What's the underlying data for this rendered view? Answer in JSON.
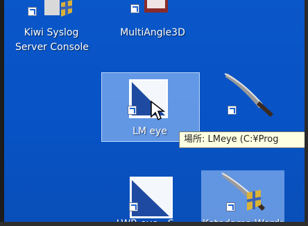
{
  "desktop": {
    "background": "#0752c4",
    "icons": {
      "kiwi": {
        "label_line1": "Kiwi Syslog",
        "label_line2": "Server Console",
        "icon": "kiwi-syslog-app-icon"
      },
      "multiangle": {
        "label": "MultiAngle3D",
        "icon": "multiangle3d-app-icon"
      },
      "lmeye": {
        "label": "LM eye",
        "icon": "lmeye-app-icon",
        "state": "selected"
      },
      "sword": {
        "icon": "sword-app-icon"
      },
      "lwbeye": {
        "label": "LWB eye",
        "label_suffix": "- S...",
        "icon": "lwbeye-app-icon"
      },
      "sword_shield": {
        "label": "Kotodama Wordmaster",
        "icon": "sword-shield-app-icon",
        "state": "hovered"
      }
    },
    "tooltip": {
      "text": "場所: LMeye (C:¥Prog"
    }
  }
}
